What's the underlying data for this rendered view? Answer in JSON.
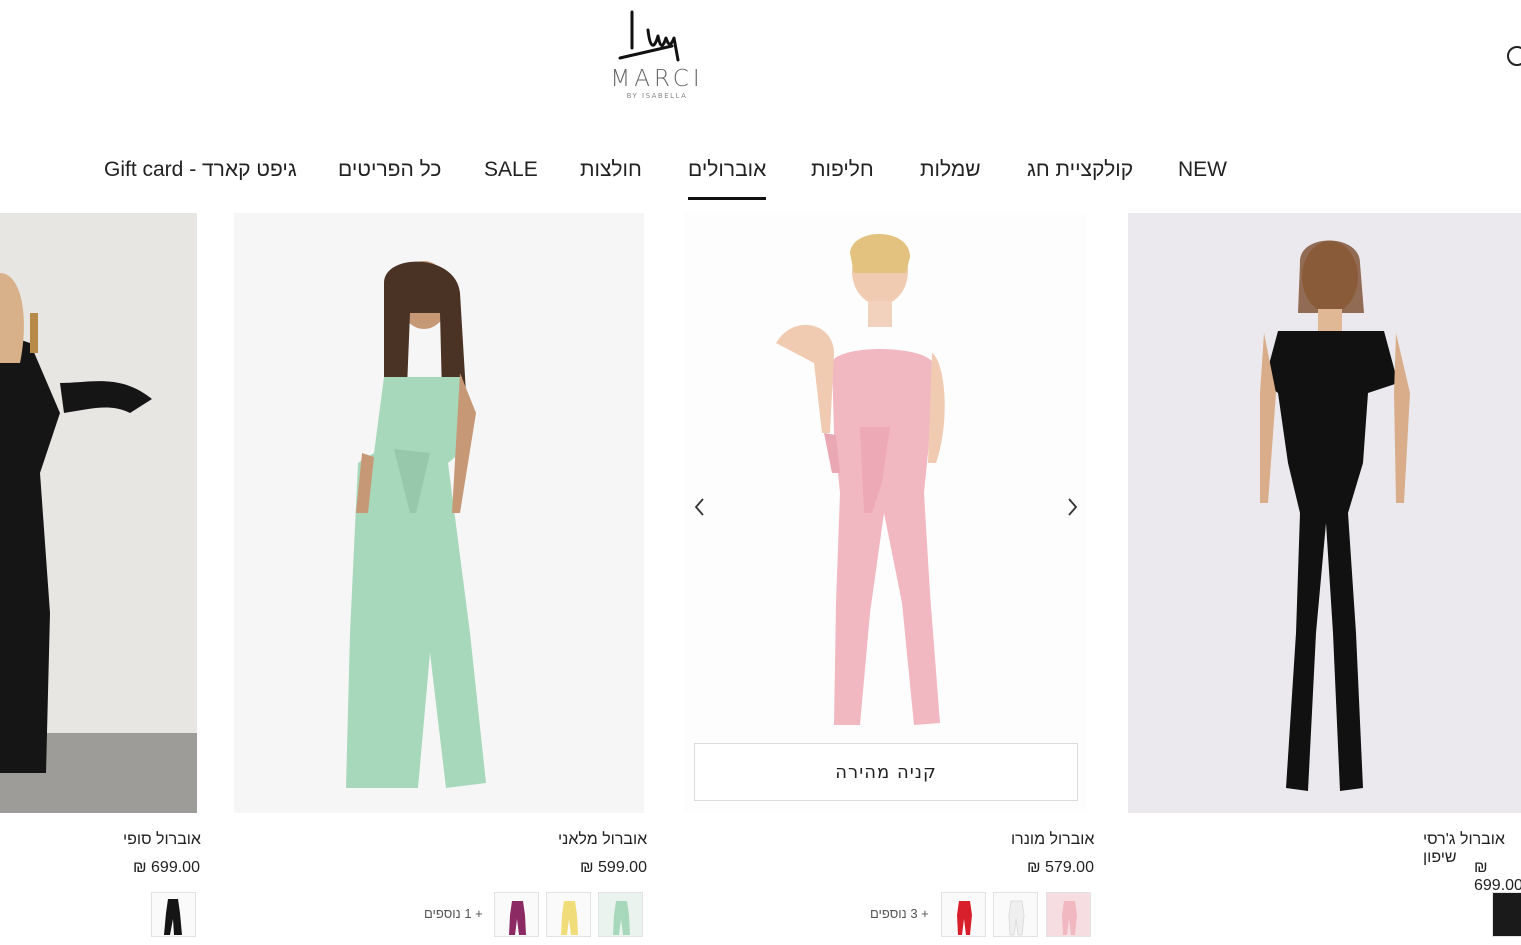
{
  "header": {
    "logo_word": "MARCI",
    "logo_sub": "BY ISABELLA"
  },
  "nav": [
    {
      "label": "NEW"
    },
    {
      "label": "קולקציית חג"
    },
    {
      "label": "שמלות"
    },
    {
      "label": "חליפות"
    },
    {
      "label": "אוברולים",
      "active": true
    },
    {
      "label": "חולצות"
    },
    {
      "label": "SALE"
    },
    {
      "label": "כל הפריטים"
    },
    {
      "label": "גיפט קארד - Gift card"
    }
  ],
  "products": [
    {
      "name": "אוברול ג'רסי שיפון",
      "price": "₪ 699.00",
      "color": "#111111"
    },
    {
      "name": "אוברול מונרו",
      "price": "₪ 579.00",
      "color": "#f2b8c2",
      "more": "+ 3 נוספים",
      "quick_buy": "קניה מהירה"
    },
    {
      "name": "אוברול מלאני",
      "price": "₪ 599.00",
      "color": "#a8d8bc",
      "more": "+ 1 נוספים"
    },
    {
      "name": "אוברול סופי",
      "price": "₪ 699.00",
      "color": "#151515"
    }
  ],
  "colors": {
    "accent": "#111111",
    "pink": "#f2b8c2",
    "mint": "#a8d8bc",
    "red": "#d8202c",
    "white": "#f6f6f6",
    "yellow": "#f0dc78",
    "plum": "#8c2a63"
  },
  "icons": {
    "search": "search-icon",
    "prev": "chevron-left-icon",
    "next": "chevron-right-icon"
  }
}
